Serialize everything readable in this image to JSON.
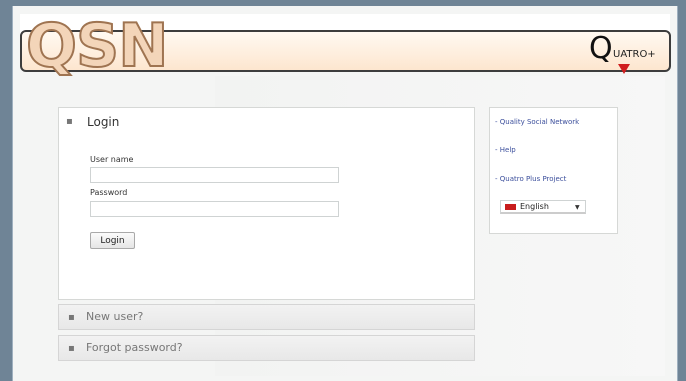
{
  "header": {
    "logo_text": "QSN",
    "partner_logo": {
      "letter": "Q",
      "text": "UATRO+"
    }
  },
  "login": {
    "title": "Login",
    "bullet": "▪",
    "username_label": "User name",
    "username_value": "",
    "password_label": "Password",
    "password_value": "",
    "button_label": "Login"
  },
  "collapsed_sections": [
    {
      "bullet": "▪",
      "label": "New user?"
    },
    {
      "bullet": "▪",
      "label": "Forgot password?"
    }
  ],
  "sidebar": {
    "links": [
      {
        "text": "- Quality Social Network"
      },
      {
        "text": "- Help"
      },
      {
        "text": "- Quatro Plus Project"
      }
    ],
    "language": "English"
  },
  "colors": {
    "background": "#6f8496",
    "header_fill": "#fde6cf",
    "logo_fill": "#f3d5b9",
    "link": "#3c4f9c",
    "flag": "#c81c1c"
  }
}
